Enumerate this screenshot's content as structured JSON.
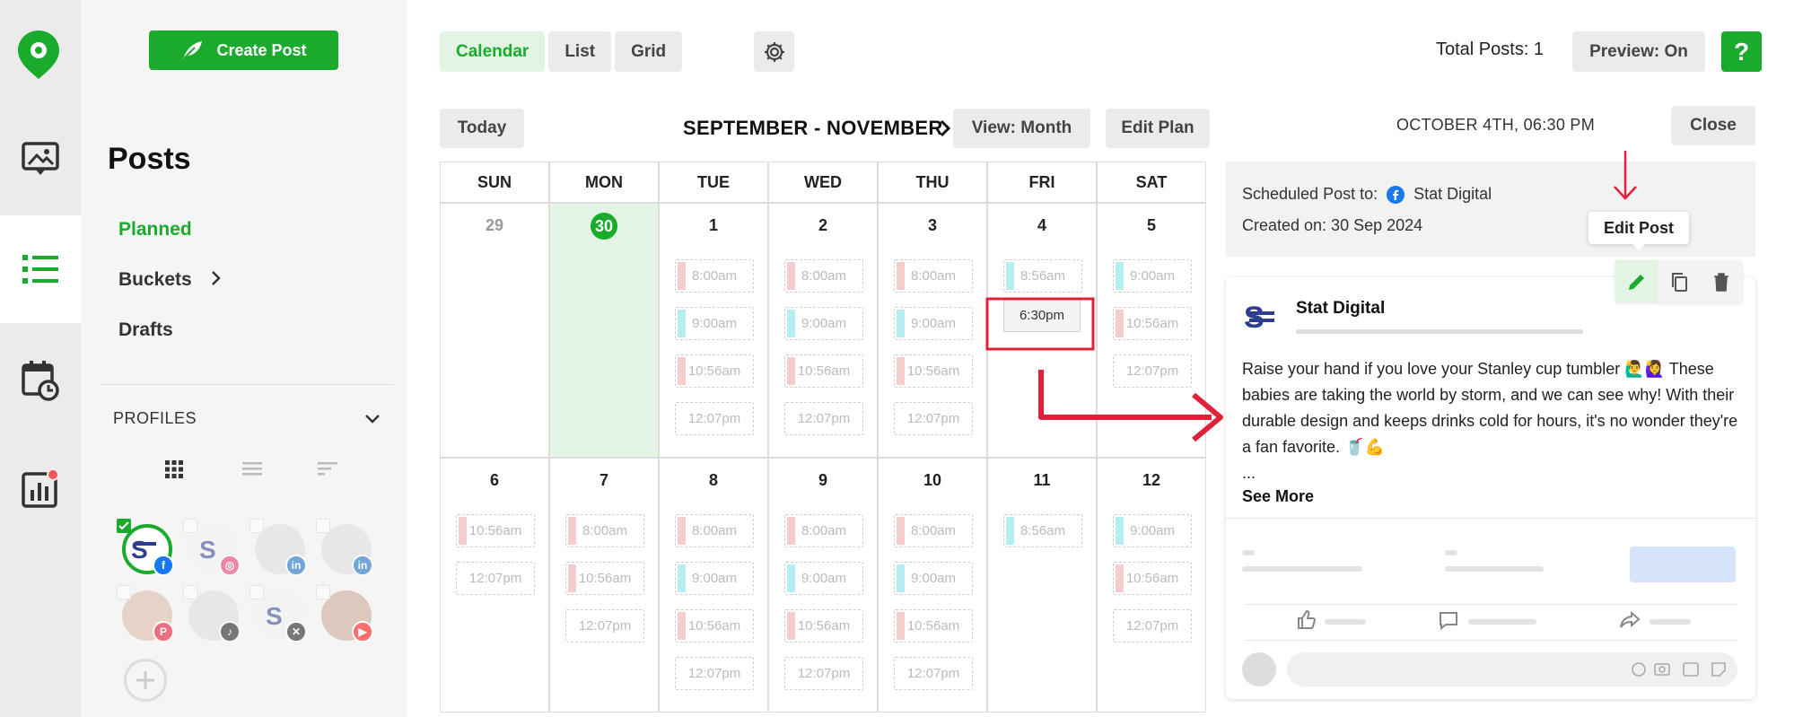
{
  "sidebar": {
    "create_label": "Create Post",
    "title": "Posts",
    "nav": [
      {
        "label": "Planned",
        "active": true
      },
      {
        "label": "Buckets",
        "active": false
      },
      {
        "label": "Drafts",
        "active": false
      }
    ],
    "profiles_label": "PROFILES"
  },
  "toolbar": {
    "tabs": [
      "Calendar",
      "List",
      "Grid"
    ],
    "active_tab": "Calendar",
    "total_label": "Total Posts: 1",
    "preview_label": "Preview: On",
    "help_label": "?"
  },
  "calendar": {
    "today_label": "Today",
    "range_label": "SEPTEMBER - NOVEMBER",
    "view_label": "View: Month",
    "edit_plan_label": "Edit Plan",
    "weekdays": [
      "SUN",
      "MON",
      "TUE",
      "WED",
      "THU",
      "FRI",
      "SAT"
    ],
    "days": [
      "29",
      "30",
      "1",
      "2",
      "3",
      "4",
      "5",
      "6",
      "7",
      "8",
      "9",
      "10",
      "11",
      "12"
    ],
    "selected_slot": "6:30pm",
    "slots": [
      [],
      [],
      [
        {
          "t": "8:00am",
          "c": "red"
        },
        {
          "t": "9:00am",
          "c": "cyan"
        },
        {
          "t": "10:56am",
          "c": "red"
        },
        {
          "t": "12:07pm",
          "c": "none"
        }
      ],
      [
        {
          "t": "8:00am",
          "c": "red"
        },
        {
          "t": "9:00am",
          "c": "cyan"
        },
        {
          "t": "10:56am",
          "c": "red"
        },
        {
          "t": "12:07pm",
          "c": "none"
        }
      ],
      [
        {
          "t": "8:00am",
          "c": "red"
        },
        {
          "t": "9:00am",
          "c": "cyan"
        },
        {
          "t": "10:56am",
          "c": "red"
        },
        {
          "t": "12:07pm",
          "c": "none"
        }
      ],
      [
        {
          "t": "8:56am",
          "c": "cyan"
        }
      ],
      [
        {
          "t": "9:00am",
          "c": "cyan"
        },
        {
          "t": "10:56am",
          "c": "red"
        },
        {
          "t": "12:07pm",
          "c": "none"
        }
      ],
      [
        {
          "t": "10:56am",
          "c": "red"
        },
        {
          "t": "12:07pm",
          "c": "none"
        }
      ],
      [
        {
          "t": "8:00am",
          "c": "red"
        },
        {
          "t": "10:56am",
          "c": "red"
        },
        {
          "t": "12:07pm",
          "c": "none"
        }
      ],
      [
        {
          "t": "8:00am",
          "c": "red"
        },
        {
          "t": "9:00am",
          "c": "cyan"
        },
        {
          "t": "10:56am",
          "c": "red"
        },
        {
          "t": "12:07pm",
          "c": "none"
        }
      ],
      [
        {
          "t": "8:00am",
          "c": "red"
        },
        {
          "t": "9:00am",
          "c": "cyan"
        },
        {
          "t": "10:56am",
          "c": "red"
        },
        {
          "t": "12:07pm",
          "c": "none"
        }
      ],
      [
        {
          "t": "8:00am",
          "c": "red"
        },
        {
          "t": "9:00am",
          "c": "cyan"
        },
        {
          "t": "10:56am",
          "c": "red"
        },
        {
          "t": "12:07pm",
          "c": "none"
        }
      ],
      [
        {
          "t": "8:56am",
          "c": "cyan"
        }
      ],
      [
        {
          "t": "9:00am",
          "c": "cyan"
        },
        {
          "t": "10:56am",
          "c": "red"
        },
        {
          "t": "12:07pm",
          "c": "none"
        }
      ]
    ]
  },
  "preview": {
    "datetime": "OCTOBER 4TH, 06:30 PM",
    "close_label": "Close",
    "scheduled_label": "Scheduled Post to:",
    "scheduled_account": "Stat Digital",
    "created_label": "Created on: 30 Sep 2024",
    "tooltip": "Edit Post",
    "page_name": "Stat Digital",
    "post_text": "Raise your hand if you love your Stanley cup tumbler 🙋‍♂️🙋‍♀️ These babies are taking the world by storm, and we can see why! With their durable design and keeps drinks cold for hours, it's no wonder they're a fan favorite. 🥤💪",
    "ellipsis": "...",
    "see_more": "See More"
  },
  "colors": {
    "brand_green": "#1aaa2c",
    "annotation_red": "#e0213a",
    "slot_red": "#f6cccc",
    "slot_cyan": "#b5eef1"
  }
}
